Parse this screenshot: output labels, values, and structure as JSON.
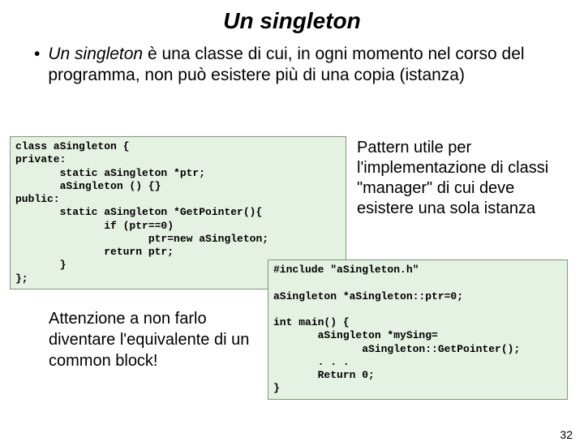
{
  "title": "Un singleton",
  "bullet": {
    "em": "Un singleton",
    "rest": " è una classe di cui, in ogni momento nel corso del programma, non può esistere più di una copia (istanza)"
  },
  "code_header": "class aSingleton {\nprivate:\n       static aSingleton *ptr;\n       aSingleton () {}\npublic:\n       static aSingleton *GetPointer(){\n              if (ptr==0)\n                     ptr=new aSingleton;\n              return ptr;\n       }\n};",
  "code_main": "#include \"aSingleton.h\"\n\naSingleton *aSingleton::ptr=0;\n\nint main() {\n       aSingleton *mySing=\n              aSingleton::GetPointer();\n       . . .\n       Return 0;\n}",
  "pattern_text": "Pattern utile per l'implementazione di classi \"manager\" di cui deve esistere una sola istanza",
  "warning_text": "Attenzione a non farlo diventare l'equivalente di un common block!",
  "page_number": "32"
}
